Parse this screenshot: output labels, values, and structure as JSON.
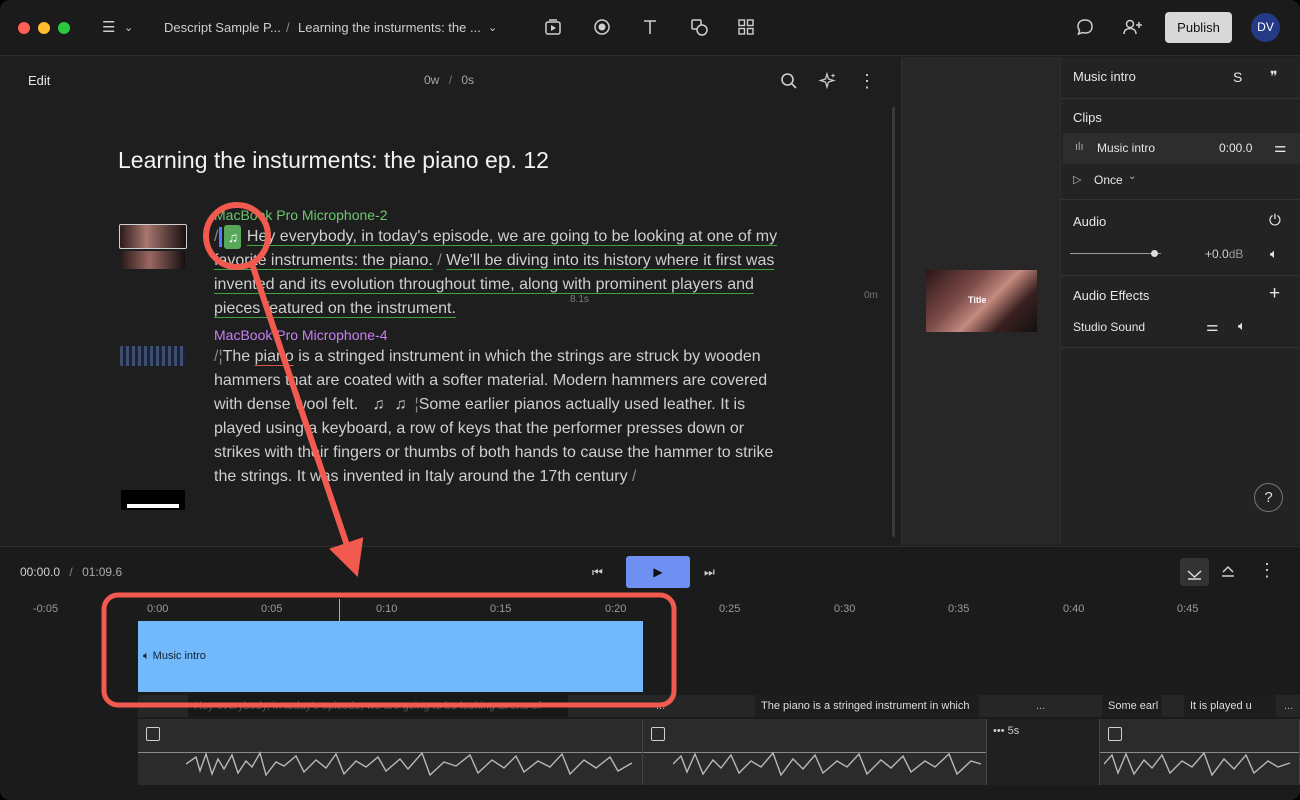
{
  "header": {
    "breadcrumb_project": "Descript Sample P...",
    "breadcrumb_sep": "/",
    "breadcrumb_doc": "Learning the insturments: the ...",
    "publish_label": "Publish",
    "avatar_initials": "DV"
  },
  "editor": {
    "edit_label": "Edit",
    "word_count": "0w",
    "sep": "/",
    "duration": "0s",
    "doc_title": "Learning the insturments: the piano ep. 12",
    "gap_label": "8.1s",
    "media_time": "0m",
    "blocks": [
      {
        "speaker": "MacBook Pro Microphone-2",
        "text_pre": "Hey everybody, in today's episode, we are going to be looking at one of my favorite instruments: the piano.",
        "text_post": "We'll be diving into its history where it first was invented and its evolution throughout time, along with prominent players and pieces featured on the instrument."
      },
      {
        "speaker": "MacBook Pro Microphone-4",
        "t1": "The ",
        "t2": "piano",
        "t3": " is a stringed instrument in which the strings are struck by wooden hammers that are coated with a softer material. Modern hammers are covered with dense wool felt.",
        "t4": "Some earlier pianos actually used leather. It is played using a keyboard, a row of keys that the performer presses down or strikes with their fingers or thumbs of both hands to cause the hammer to strike the strings. It was invented in Italy around the 17th century"
      }
    ]
  },
  "preview": {
    "thumb_title": "Title"
  },
  "panel": {
    "title": "Music intro",
    "s_label": "S",
    "clips_heading": "Clips",
    "clip_name": "Music intro",
    "clip_time": "0:00.0",
    "loop_label": "Once",
    "audio_heading": "Audio",
    "volume": "+0.0",
    "volume_unit": "dB",
    "effects_heading": "Audio Effects",
    "effect_name": "Studio Sound",
    "help": "?"
  },
  "timeline": {
    "current_time": "00:00.0",
    "sep": "/",
    "total_time": "01:09.6",
    "ticks": [
      "-0:05",
      "0:00",
      "0:05",
      "0:10",
      "0:15",
      "0:20",
      "0:25",
      "0:30",
      "0:35",
      "0:40",
      "0:45"
    ],
    "music_clip_label": "Music intro",
    "script_segments": [
      "Hey everybody, in today's episode, we are going to be looking at one of",
      "...",
      "The piano is a stringed instrument in which",
      "...",
      "Some earl",
      "It is played u",
      "..."
    ],
    "gap_clip_label": "5s"
  },
  "colors": {
    "accent_blue": "#6f8ff2",
    "music_clip": "#72b9fc",
    "annotation_red": "#f25a4f",
    "speaker1": "#6cc86f",
    "speaker2": "#c780f2"
  }
}
